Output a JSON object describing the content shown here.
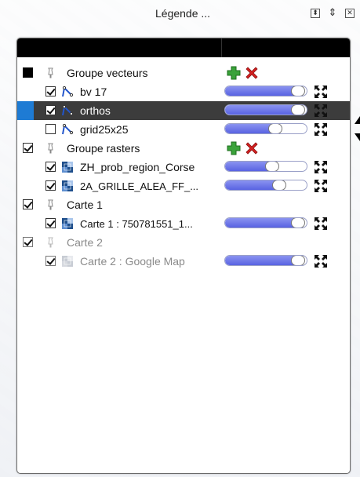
{
  "window": {
    "title": "Légende ...",
    "float_icon": "float-icon",
    "pin_icon": "pin-icon",
    "close_icon": "close-icon"
  },
  "colors": {
    "selection_bg": "#3c3c3c",
    "selection_accent": "#1e7bd4",
    "slider_fill": "#5963e2",
    "add_green": "#3aa23a",
    "delete_red": "#d42020"
  },
  "tree": [
    {
      "kind": "group",
      "label": "Groupe vecteurs",
      "checkbox": "filled",
      "has_actions": true
    },
    {
      "kind": "layer",
      "label": "bv 17",
      "icon": "vector-line-icon",
      "checked": true,
      "opacity": 0.95
    },
    {
      "kind": "layer",
      "label": "orthos",
      "icon": "vector-line-icon",
      "checked": true,
      "opacity": 0.95,
      "selected": true
    },
    {
      "kind": "layer",
      "label": "grid25x25",
      "icon": "vector-line-icon",
      "checked": false,
      "opacity": 0.63
    },
    {
      "kind": "group",
      "label": "Groupe rasters",
      "checkbox": "checked",
      "has_actions": true
    },
    {
      "kind": "layer",
      "label": "ZH_prob_region_Corse",
      "icon": "raster-icon",
      "checked": true,
      "opacity": 0.58
    },
    {
      "kind": "layer",
      "label": "2A_GRILLE_ALEA_FF_...",
      "icon": "raster-icon",
      "checked": true,
      "opacity": 0.68,
      "small": true
    },
    {
      "kind": "group",
      "label": "Carte 1",
      "checkbox": "checked",
      "has_actions": false
    },
    {
      "kind": "layer",
      "label": "Carte 1 : 750781551_1...",
      "icon": "raster-icon",
      "checked": true,
      "opacity": 0.95,
      "small": true
    },
    {
      "kind": "group",
      "label": "Carte 2",
      "checkbox": "checked",
      "has_actions": false,
      "muted": true
    },
    {
      "kind": "layer",
      "label": "Carte 2 : Google Map",
      "icon": "raster-icon",
      "checked": true,
      "opacity": 0.95,
      "muted": true
    }
  ]
}
